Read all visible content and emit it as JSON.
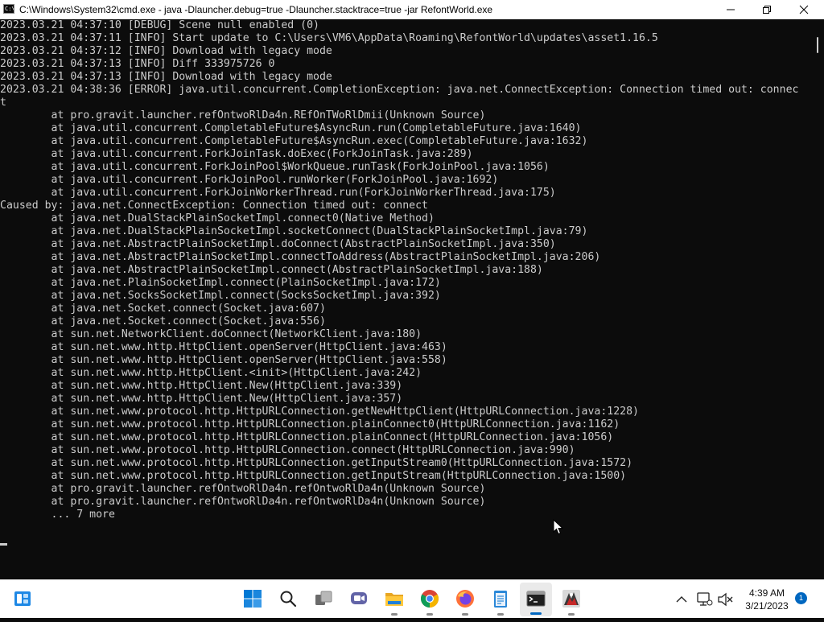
{
  "window": {
    "title": "C:\\Windows\\System32\\cmd.exe - java  -Dlauncher.debug=true -Dlauncher.stacktrace=true -jar RefontWorld.exe",
    "icon_label": "C:\\"
  },
  "console": {
    "lines": [
      "2023.03.21 04:37:10 [DEBUG] Scene null enabled (0)",
      "2023.03.21 04:37:11 [INFO] Start update to C:\\Users\\VM6\\AppData\\Roaming\\RefontWorld\\updates\\asset1.16.5",
      "2023.03.21 04:37:12 [INFO] Download with legacy mode",
      "2023.03.21 04:37:13 [INFO] Diff 333975726 0",
      "2023.03.21 04:37:13 [INFO] Download with legacy mode",
      "2023.03.21 04:38:36 [ERROR] java.util.concurrent.CompletionException: java.net.ConnectException: Connection timed out: connec",
      "t",
      "        at pro.gravit.launcher.refOntwoRlDa4n.REfOnTWoRlDmii(Unknown Source)",
      "        at java.util.concurrent.CompletableFuture$AsyncRun.run(CompletableFuture.java:1640)",
      "        at java.util.concurrent.CompletableFuture$AsyncRun.exec(CompletableFuture.java:1632)",
      "        at java.util.concurrent.ForkJoinTask.doExec(ForkJoinTask.java:289)",
      "        at java.util.concurrent.ForkJoinPool$WorkQueue.runTask(ForkJoinPool.java:1056)",
      "        at java.util.concurrent.ForkJoinPool.runWorker(ForkJoinPool.java:1692)",
      "        at java.util.concurrent.ForkJoinWorkerThread.run(ForkJoinWorkerThread.java:175)",
      "Caused by: java.net.ConnectException: Connection timed out: connect",
      "        at java.net.DualStackPlainSocketImpl.connect0(Native Method)",
      "        at java.net.DualStackPlainSocketImpl.socketConnect(DualStackPlainSocketImpl.java:79)",
      "        at java.net.AbstractPlainSocketImpl.doConnect(AbstractPlainSocketImpl.java:350)",
      "        at java.net.AbstractPlainSocketImpl.connectToAddress(AbstractPlainSocketImpl.java:206)",
      "        at java.net.AbstractPlainSocketImpl.connect(AbstractPlainSocketImpl.java:188)",
      "        at java.net.PlainSocketImpl.connect(PlainSocketImpl.java:172)",
      "        at java.net.SocksSocketImpl.connect(SocksSocketImpl.java:392)",
      "        at java.net.Socket.connect(Socket.java:607)",
      "        at java.net.Socket.connect(Socket.java:556)",
      "        at sun.net.NetworkClient.doConnect(NetworkClient.java:180)",
      "        at sun.net.www.http.HttpClient.openServer(HttpClient.java:463)",
      "        at sun.net.www.http.HttpClient.openServer(HttpClient.java:558)",
      "        at sun.net.www.http.HttpClient.<init>(HttpClient.java:242)",
      "        at sun.net.www.http.HttpClient.New(HttpClient.java:339)",
      "        at sun.net.www.http.HttpClient.New(HttpClient.java:357)",
      "        at sun.net.www.protocol.http.HttpURLConnection.getNewHttpClient(HttpURLConnection.java:1228)",
      "        at sun.net.www.protocol.http.HttpURLConnection.plainConnect0(HttpURLConnection.java:1162)",
      "        at sun.net.www.protocol.http.HttpURLConnection.plainConnect(HttpURLConnection.java:1056)",
      "        at sun.net.www.protocol.http.HttpURLConnection.connect(HttpURLConnection.java:990)",
      "        at sun.net.www.protocol.http.HttpURLConnection.getInputStream0(HttpURLConnection.java:1572)",
      "        at sun.net.www.protocol.http.HttpURLConnection.getInputStream(HttpURLConnection.java:1500)",
      "        at pro.gravit.launcher.refOntwoRlDa4n.refOntwoRlDa4n(Unknown Source)",
      "        at pro.gravit.launcher.refOntwoRlDa4n.refOntwoRlDa4n(Unknown Source)",
      "        ... 7 more"
    ]
  },
  "taskbar": {
    "items": [
      {
        "icon": "widgets-icon",
        "running": false
      },
      {
        "icon": "start-icon",
        "running": false
      },
      {
        "icon": "search-icon",
        "running": false
      },
      {
        "icon": "task-view-icon",
        "running": false
      },
      {
        "icon": "chat-icon",
        "running": false
      },
      {
        "icon": "file-explorer-icon",
        "running": true
      },
      {
        "icon": "chrome-icon",
        "running": true
      },
      {
        "icon": "firefox-icon",
        "running": true
      },
      {
        "icon": "notepad-icon",
        "running": true
      },
      {
        "icon": "terminal-icon",
        "running": true,
        "active": true
      },
      {
        "icon": "launcher-icon",
        "running": true
      }
    ]
  },
  "tray": {
    "time": "4:39 AM",
    "date": "3/21/2023",
    "notification_count": "1"
  },
  "colors": {
    "console_bg": "#0c0c0c",
    "console_fg": "#cccccc",
    "accent": "#0067c0"
  }
}
